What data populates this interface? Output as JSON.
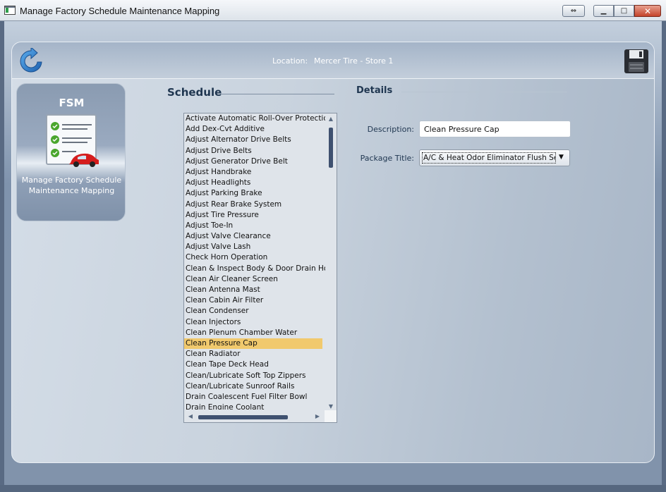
{
  "window": {
    "title": "Manage Factory Schedule Maintenance Mapping",
    "buttons": {
      "minimize": "▁",
      "maximize": "□",
      "close": "✕",
      "swap": "⇔"
    }
  },
  "header": {
    "location_label": "Location:",
    "location_value": "Mercer Tire - Store 1"
  },
  "fsm_card": {
    "title": "FSM",
    "caption": "Manage Factory Schedule Maintenance Mapping"
  },
  "schedule": {
    "title": "Schedule",
    "items": [
      "Activate Automatic Roll-Over Protection",
      "Add Dex-Cvt Additive",
      "Adjust Alternator Drive Belts",
      "Adjust Drive Belts",
      "Adjust Generator Drive Belt",
      "Adjust Handbrake",
      "Adjust Headlights",
      "Adjust Parking Brake",
      "Adjust Rear Brake System",
      "Adjust Tire Pressure",
      "Adjust Toe-In",
      "Adjust Valve Clearance",
      "Adjust Valve Lash",
      "Check Horn Operation",
      "Clean & Inspect Body & Door Drain Holes",
      "Clean Air Cleaner Screen",
      "Clean Antenna Mast",
      "Clean Cabin Air Filter",
      "Clean Condenser",
      "Clean Injectors",
      "Clean Plenum Chamber Water",
      "Clean Pressure Cap",
      "Clean Radiator",
      "Clean Tape Deck Head",
      "Clean/Lubricate Soft Top Zippers",
      "Clean/Lubricate Sunroof Rails",
      "Drain Coalescent Fuel Filter Bowl",
      "Drain Engine Coolant"
    ],
    "selected_index": 21
  },
  "details": {
    "title": "Details",
    "description_label": "Description:",
    "description_value": "Clean Pressure Cap",
    "package_label": "Package Title:",
    "package_value": "A/C & Heat Odor Eliminator Flush Service"
  },
  "colors": {
    "selected_row": "#f1c96d",
    "section_title": "#1f3650",
    "scroll_thumb": "#3f5170"
  },
  "icons": [
    "refresh-icon",
    "save-icon",
    "checklist-car-icon"
  ]
}
